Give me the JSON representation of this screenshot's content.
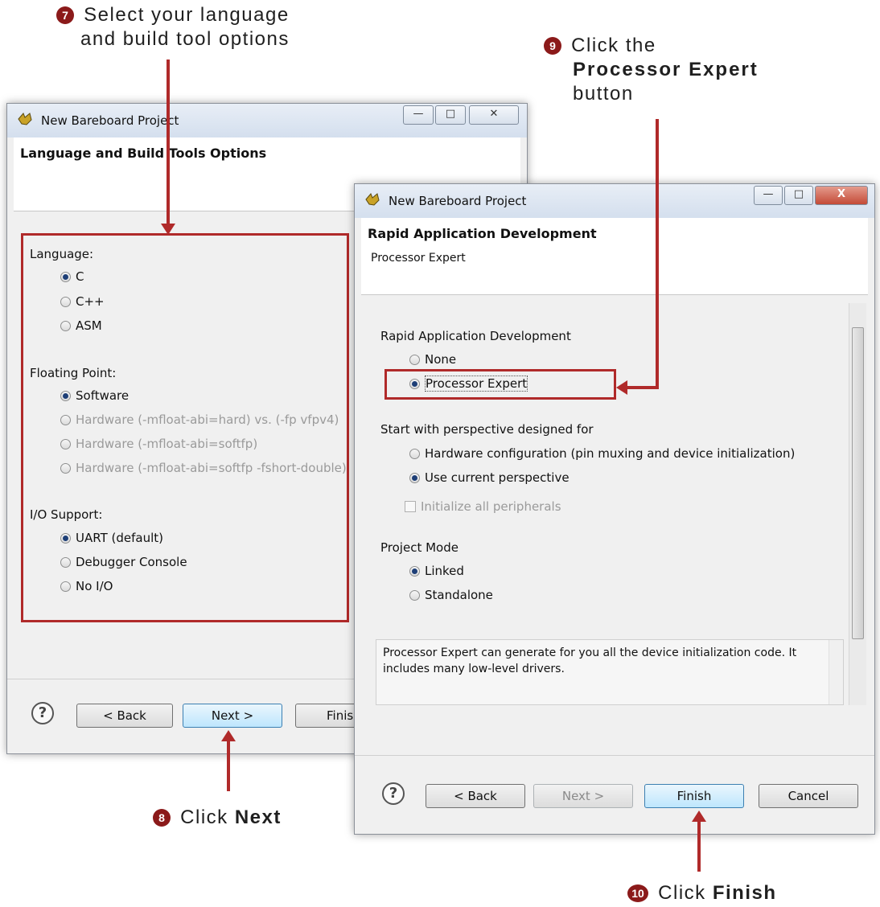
{
  "callouts": {
    "c7": {
      "num": "7",
      "line1": "Select your language",
      "line2": "and build tool options"
    },
    "c8": {
      "num": "8",
      "text": "Click",
      "bold": "Next"
    },
    "c9": {
      "num": "9",
      "line1": "Click the",
      "bold": "Processor Expert",
      "line3": "button"
    },
    "c10": {
      "num": "10",
      "text": "Click",
      "bold": "Finish"
    }
  },
  "win1": {
    "title": "New Bareboard Project",
    "header": "Language and Build Tools Options",
    "language_label": "Language:",
    "language_options": [
      "C",
      "C++",
      "ASM"
    ],
    "language_selected": "C",
    "fp_label": "Floating Point:",
    "fp_options": [
      "Software",
      "Hardware (-mfloat-abi=hard) vs. (-fp vfpv4)",
      "Hardware (-mfloat-abi=softfp)",
      "Hardware (-mfloat-abi=softfp -fshort-double)"
    ],
    "fp_selected": "Software",
    "io_label": "I/O Support:",
    "io_options": [
      "UART (default)",
      "Debugger Console",
      "No I/O"
    ],
    "io_selected": "UART (default)",
    "buttons": {
      "help": "?",
      "back": "< Back",
      "next": "Next >",
      "finish": "Finis"
    },
    "tb": {
      "min": "—",
      "max": "□",
      "close": "✕"
    }
  },
  "win2": {
    "title": "New Bareboard Project",
    "header_title": "Rapid Application Development",
    "header_sub": "Processor Expert",
    "rad_label": "Rapid Application Development",
    "rad_options": [
      "None",
      "Processor Expert"
    ],
    "rad_selected": "Processor Expert",
    "persp_label": "Start with perspective designed for",
    "persp_options": [
      "Hardware configuration (pin muxing and device initialization)",
      "Use current perspective"
    ],
    "persp_selected": "Use current perspective",
    "init_label": "Initialize all peripherals",
    "mode_label": "Project Mode",
    "mode_options": [
      "Linked",
      "Standalone"
    ],
    "mode_selected": "Linked",
    "description": "Processor Expert can generate for you all the device initialization code. It includes many low-level drivers.",
    "buttons": {
      "help": "?",
      "back": "< Back",
      "next": "Next >",
      "finish": "Finish",
      "cancel": "Cancel"
    },
    "tb": {
      "min": "—",
      "max": "□",
      "close": "X"
    }
  },
  "colors": {
    "accent_red": "#b02a2a",
    "callout_num": "#8b1a1a"
  }
}
